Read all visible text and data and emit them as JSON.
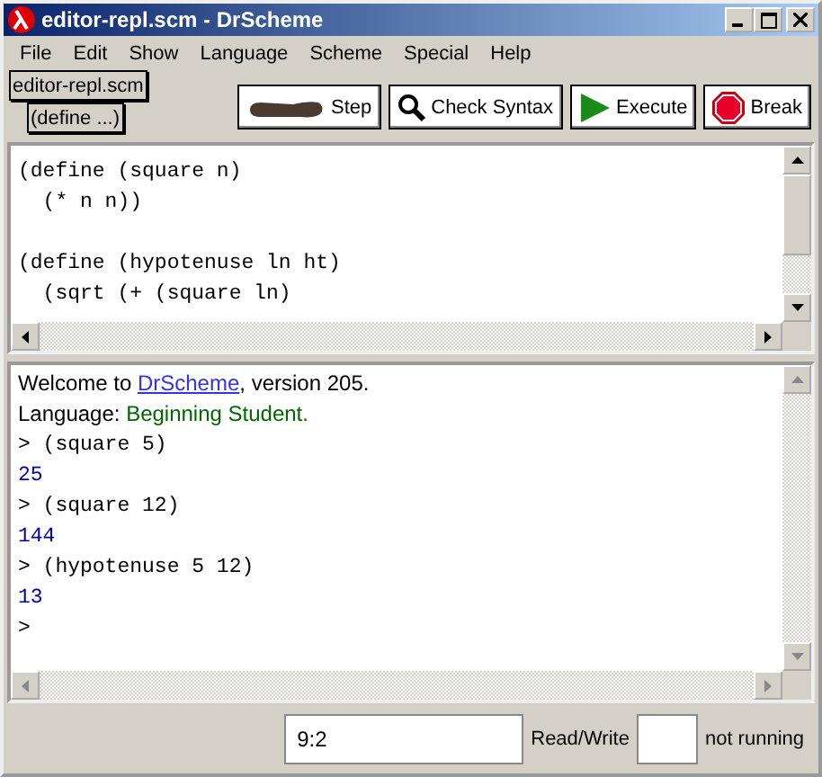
{
  "window": {
    "title": "editor-repl.scm - DrScheme"
  },
  "menu": [
    "File",
    "Edit",
    "Show",
    "Language",
    "Scheme",
    "Special",
    "Help"
  ],
  "file_label": "editor-repl.scm",
  "define_menu": "(define ...)",
  "toolbar": [
    {
      "kind": "step",
      "label": "Step"
    },
    {
      "kind": "check",
      "label": "Check Syntax"
    },
    {
      "kind": "execute",
      "label": "Execute"
    },
    {
      "kind": "break",
      "label": "Break"
    }
  ],
  "editor": {
    "blocks": [
      [
        "(define (square n)",
        "  (* n n))"
      ],
      [
        "(define (hypotenuse ln ht)",
        "  (sqrt (+ (square ln)"
      ]
    ]
  },
  "repl": {
    "welcome": {
      "before": "Welcome to ",
      "link": "DrScheme",
      "after": ", version 205."
    },
    "language": {
      "label": "Language: ",
      "value": "Beginning Student."
    },
    "lines": [
      {
        "kind": "input",
        "text": "> (square 5)"
      },
      {
        "kind": "output",
        "text": "25"
      },
      {
        "kind": "input",
        "text": "> (square 12)"
      },
      {
        "kind": "output",
        "text": "144"
      },
      {
        "kind": "input",
        "text": "> (hypotenuse 5 12)"
      },
      {
        "kind": "output",
        "text": "13"
      },
      {
        "kind": "input",
        "text": ">"
      }
    ]
  },
  "status_bar": {
    "position": "9:2",
    "mode": "Read/Write",
    "state": "not running"
  }
}
